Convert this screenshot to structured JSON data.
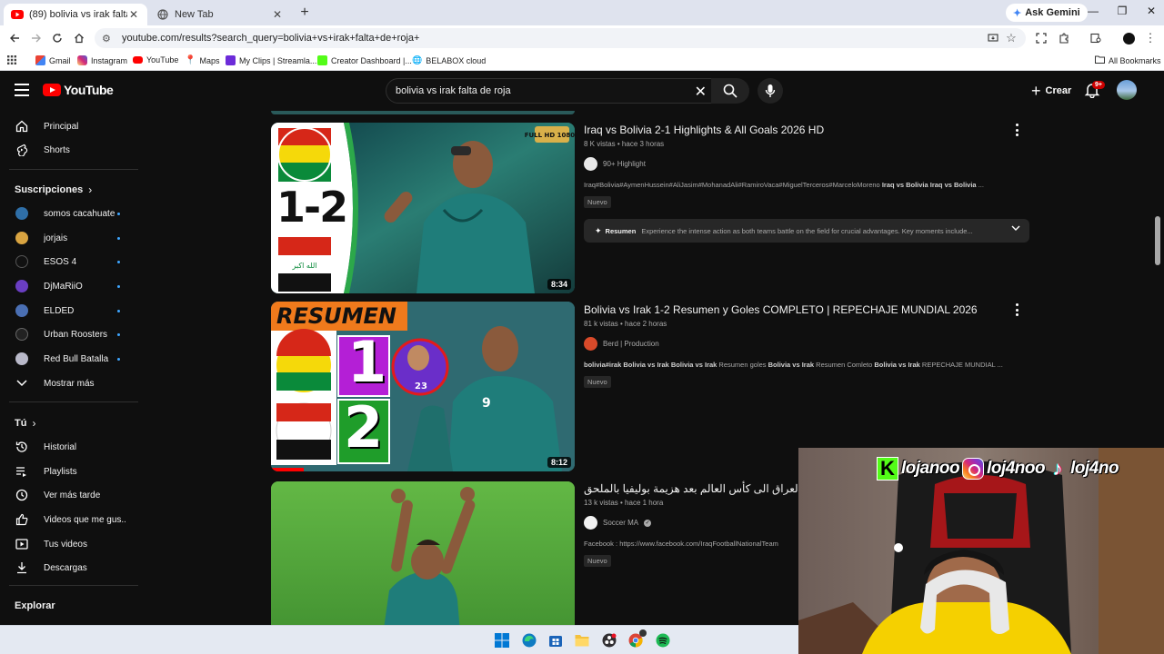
{
  "browser": {
    "tabs": [
      {
        "label": "(89) bolivia vs irak falta de roja",
        "active": true
      },
      {
        "label": "New Tab",
        "active": false
      }
    ],
    "ask_gemini": "Ask Gemini",
    "url": "youtube.com/results?search_query=bolivia+vs+irak+falta+de+roja+",
    "bookmarks": [
      "Gmail",
      "Instagram",
      "YouTube",
      "Maps",
      "My Clips | Streamla...",
      "Creator Dashboard |...",
      "BELABOX cloud"
    ],
    "all_bookmarks": "All Bookmarks"
  },
  "youtube": {
    "logo_text": "YouTube",
    "search_value": "bolivia vs irak falta de roja",
    "create_label": "Crear",
    "notification_count": "9+"
  },
  "sidebar": {
    "main": [
      {
        "label": "Principal",
        "icon": "home-icon"
      },
      {
        "label": "Shorts",
        "icon": "shorts-icon"
      }
    ],
    "subscriptions_title": "Suscripciones",
    "subscriptions": [
      {
        "label": "somos cacahuate",
        "color": "#2f6fa8"
      },
      {
        "label": "jorjais",
        "color": "#d9a441"
      },
      {
        "label": "ESOS 4",
        "color": "#111111"
      },
      {
        "label": "DjMaRiiO",
        "color": "#6a3ec2"
      },
      {
        "label": "ELDED",
        "color": "#4a6fb3"
      },
      {
        "label": "Urban Roosters",
        "color": "#222222"
      },
      {
        "label": "Red Bull Batalla",
        "color": "#b9b9c9"
      }
    ],
    "show_more": "Mostrar más",
    "you_title": "Tú",
    "you": [
      {
        "label": "Historial",
        "icon": "history-icon"
      },
      {
        "label": "Playlists",
        "icon": "playlists-icon"
      },
      {
        "label": "Ver más tarde",
        "icon": "watch-later-icon"
      },
      {
        "label": "Videos que me gus...",
        "icon": "like-icon"
      },
      {
        "label": "Tus videos",
        "icon": "your-videos-icon"
      },
      {
        "label": "Descargas",
        "icon": "download-icon"
      }
    ],
    "explore_title": "Explorar"
  },
  "results": [
    {
      "title": "Iraq vs Bolivia 2-1 Highlights & All Goals 2026 HD",
      "meta": "8 K vistas • hace 3 horas",
      "channel": "90+ Highlight",
      "desc_tags": "Iraq#Bolivia#AymenHussein#AliJasim#MohanadAli#RamiroVaca#MiguelTerceros#MarceloMoreno",
      "desc_bold": "Iraq vs Bolivia Iraq vs Bolivia",
      "desc_end": "...",
      "badge": "Nuevo",
      "duration": "8:34",
      "summary_label": "Resumen",
      "summary_text": "Experience the intense action as both teams battle on the field for crucial advantages. Key moments include...",
      "thumb_score": "1-2",
      "thumb_badge": "FULL HD 1080P"
    },
    {
      "title": "Bolivia vs Irak 1-2 Resumen y Goles COMPLETO | REPECHAJE MUNDIAL 2026",
      "meta": "81 k vistas • hace 2 horas",
      "channel": "Berd | Production",
      "desc_bold1": "bolivia#irak Bolivia vs Irak Bolivia vs Irak",
      "desc_mid1": " Resumen goles ",
      "desc_bold2": "Bolivia vs Irak",
      "desc_mid2": " Resumen Comleto ",
      "desc_bold3": "Bolivia vs Irak",
      "desc_end": " REPECHAJE MUNDIAL ...",
      "badge": "Nuevo",
      "duration": "8:12",
      "thumb_heading": "RESUMEN",
      "thumb_num1": "1",
      "thumb_num2": "2",
      "thumb_jersey": "9",
      "thumb_gk_number": "23"
    },
    {
      "title": "العراق الى كأس العالم بعد هزيمة بوليفيا بالملحق",
      "meta": "13 k vistas • hace 1 hora",
      "channel": "Soccer MA",
      "desc": "Facebook : https://www.facebook.com/IraqFootballNationalTeam",
      "badge": "Nuevo"
    }
  ],
  "stream_overlay": {
    "handle_kick": "lojanoo",
    "handle_instagram": "loj4noo",
    "handle_tiktok": "loj4no",
    "kick_letter": "K"
  },
  "colors": {
    "yt_bg": "#0f0f0f",
    "yt_red": "#ff0000",
    "kick_green": "#53fc18",
    "link_blue": "#3ea6ff"
  }
}
